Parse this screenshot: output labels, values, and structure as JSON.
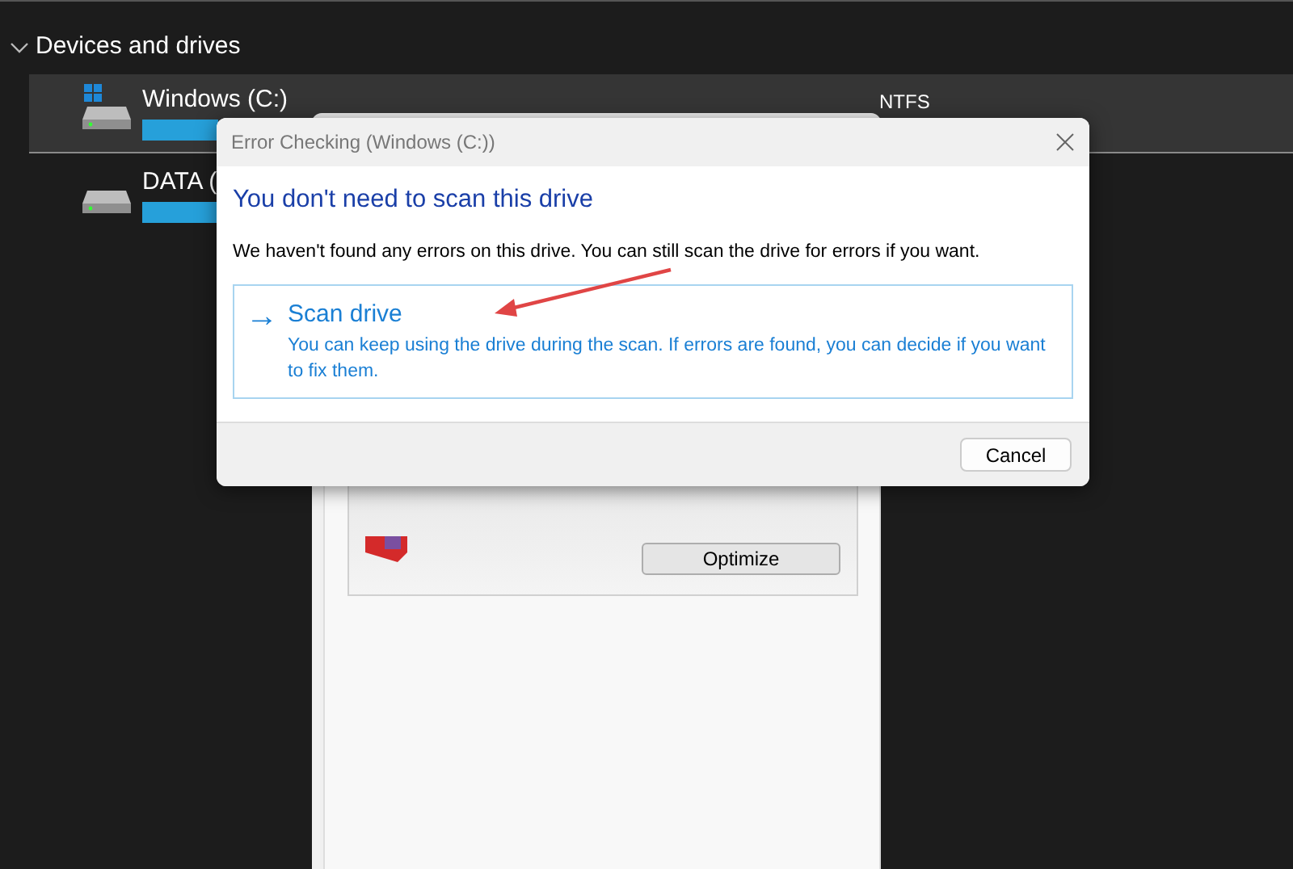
{
  "explorer": {
    "section": {
      "title": "Devices and drives",
      "expanded": true
    },
    "drives": [
      {
        "name": "Windows (C:)",
        "kind": "system",
        "selected": true,
        "level": 1,
        "filesystem": "NTFS"
      },
      {
        "name": "DATA (",
        "kind": "data",
        "selected": false,
        "level": 1
      }
    ]
  },
  "properties_window": {
    "button": "Optimize"
  },
  "dialog": {
    "title": "Error Checking (Windows (C:))",
    "heading": "You don't need to scan this drive",
    "message": "We haven't found any errors on this drive. You can still scan the drive for errors if you want.",
    "command": {
      "glyph": "→",
      "label": "Scan drive",
      "description": "You can keep using the drive during the scan. If errors are found, you can decide if you want to fix them."
    },
    "buttons": [
      "Cancel"
    ]
  }
}
